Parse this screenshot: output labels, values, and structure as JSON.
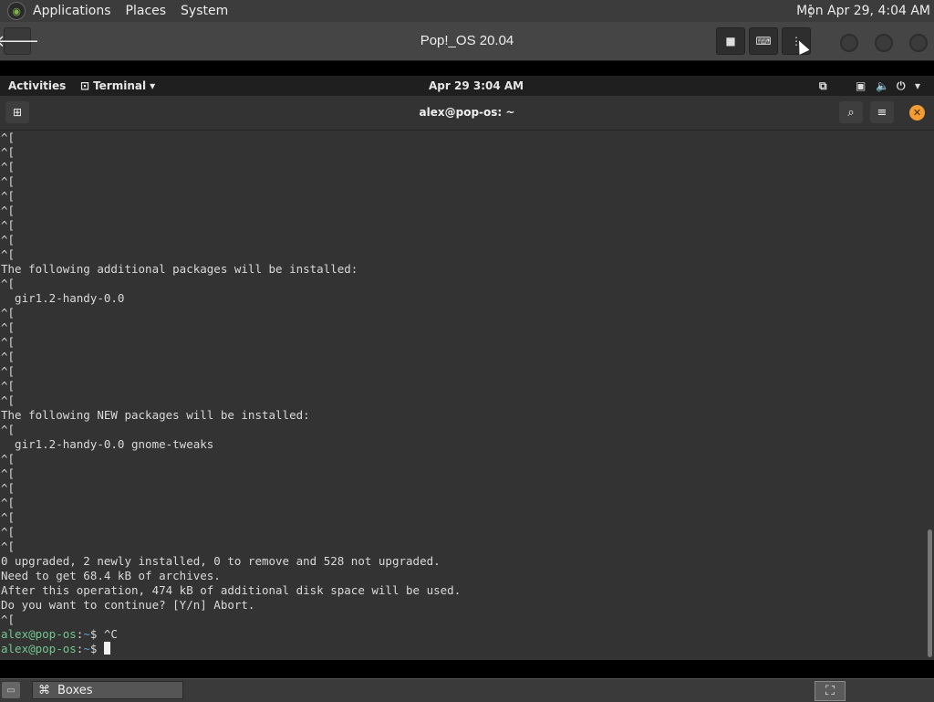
{
  "host_panel": {
    "menus": [
      "Applications",
      "Places",
      "System"
    ],
    "clock": "Mon Apr 29,  4:04 AM"
  },
  "boxes_header": {
    "title": "Pop!_OS 20.04",
    "back_icon": "back-arrow-icon",
    "buttons": [
      "stop-icon",
      "keyboard-icon",
      "menu-icon"
    ]
  },
  "guest_bar": {
    "activities": "Activities",
    "app_menu": "Terminal",
    "clock": "Apr 29   3:04 AM"
  },
  "terminal": {
    "title": "alex@pop-os: ~",
    "lines": [
      "^[",
      "^[",
      "^[",
      "^[",
      "^[",
      "^[",
      "^[",
      "^[",
      "^[",
      "The following additional packages will be installed:",
      "^[",
      "  gir1.2-handy-0.0",
      "^[",
      "^[",
      "^[",
      "^[",
      "^[",
      "^[",
      "^[",
      "The following NEW packages will be installed:",
      "^[",
      "  gir1.2-handy-0.0 gnome-tweaks",
      "^[",
      "^[",
      "^[",
      "^[",
      "^[",
      "^[",
      "^[",
      "0 upgraded, 2 newly installed, 0 to remove and 528 not upgraded.",
      "Need to get 68.4 kB of archives.",
      "After this operation, 474 kB of additional disk space will be used.",
      "Do you want to continue? [Y/n] Abort.",
      "^["
    ],
    "prompts": [
      {
        "user": "alex@pop-os",
        "sep": ":",
        "path": "~",
        "tail": "$ ^C"
      },
      {
        "user": "alex@pop-os",
        "sep": ":",
        "path": "~",
        "tail": "$ "
      }
    ]
  },
  "taskbar": {
    "task_label": "Boxes"
  }
}
